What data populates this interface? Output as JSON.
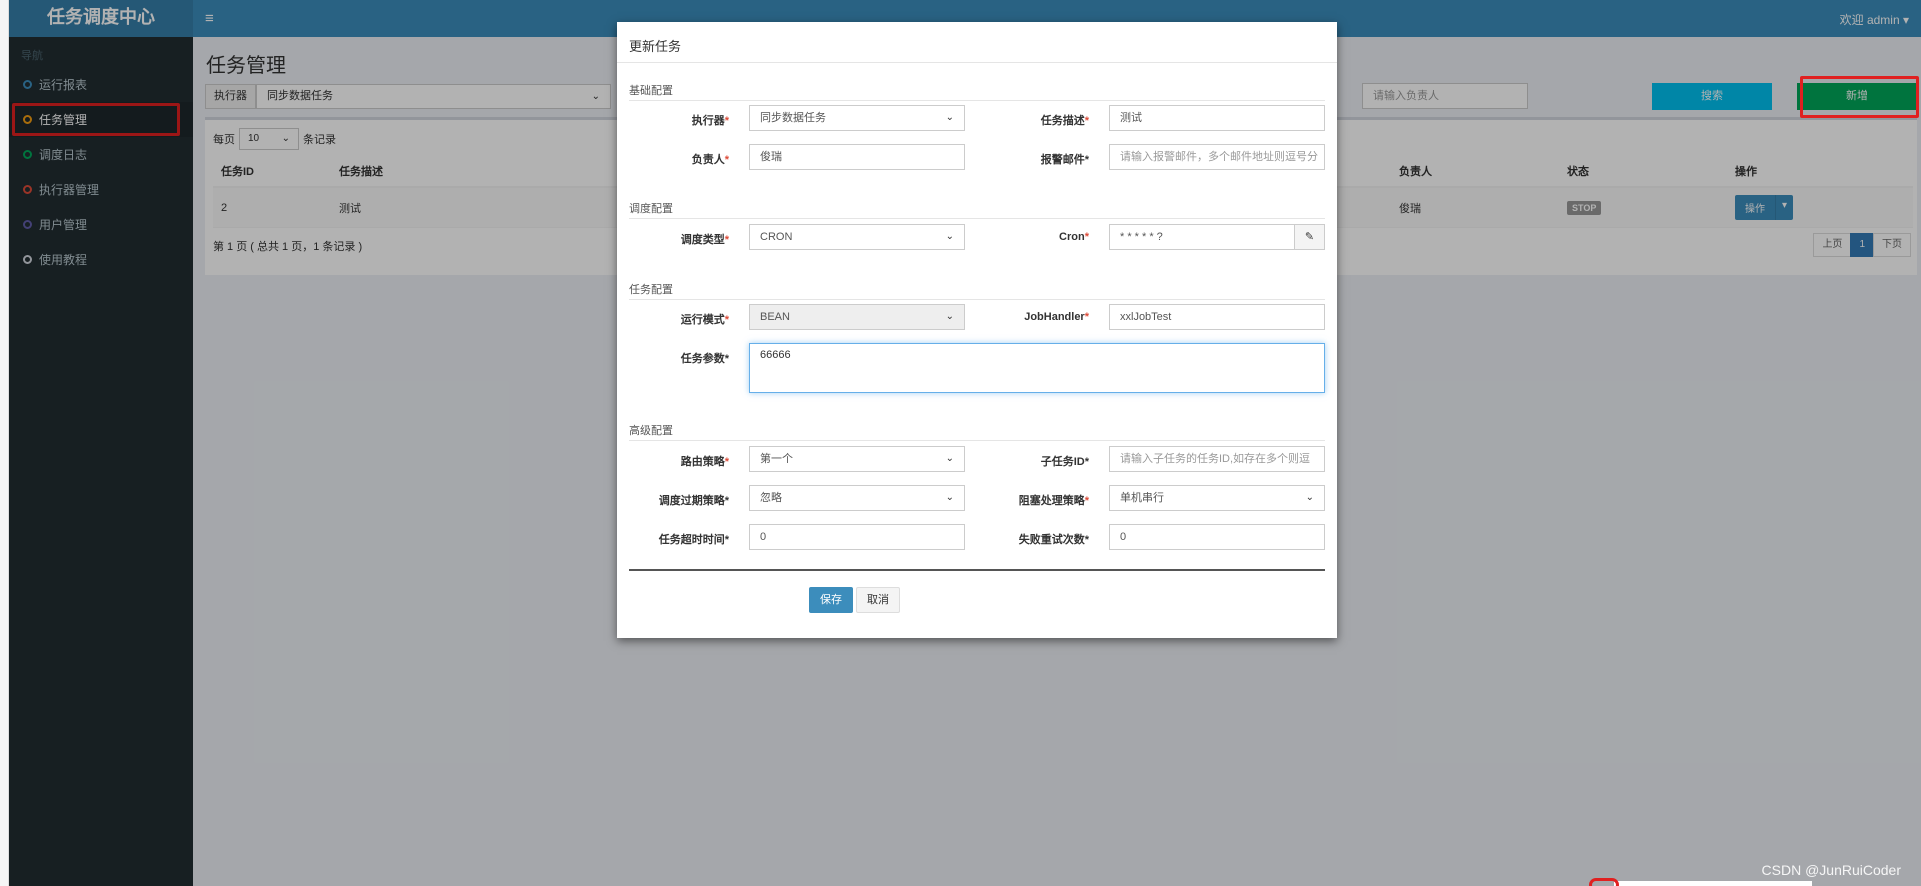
{
  "app": {
    "brand": "任务调度中心",
    "hamburger_icon": "≡",
    "welcome": "欢迎 admin ▾"
  },
  "sidebar": {
    "header": "导航",
    "items": [
      {
        "label": "运行报表",
        "color": "#3c8dbc"
      },
      {
        "label": "任务管理",
        "color": "#f39c12"
      },
      {
        "label": "调度日志",
        "color": "#00a65a"
      },
      {
        "label": "执行器管理",
        "color": "#dd4b39"
      },
      {
        "label": "用户管理",
        "color": "#605ca8"
      },
      {
        "label": "使用教程",
        "color": "#d2d6de"
      }
    ]
  },
  "page": {
    "title": "任务管理",
    "filter": {
      "executor_label": "执行器",
      "executor_value": "同步数据任务"
    },
    "search_placeholder": "请输入负责人",
    "search_button": "搜索",
    "add_button": "新增",
    "per_page_prefix": "每页",
    "per_page_value": "10",
    "per_page_suffix": "条记录",
    "table": {
      "headers": [
        "任务ID",
        "任务描述",
        "负责人",
        "状态",
        "操作"
      ],
      "rows": [
        {
          "id": "2",
          "desc": "测试",
          "owner": "俊瑞",
          "status": "STOP",
          "op": "操作"
        }
      ]
    },
    "page_info": "第 1 页 ( 总共 1 页，1 条记录 )",
    "pager": {
      "prev": "上页",
      "current": "1",
      "next": "下页"
    }
  },
  "modal": {
    "title": "更新任务",
    "sections": {
      "basic": "基础配置",
      "schedule": "调度配置",
      "task": "任务配置",
      "advanced": "高级配置"
    },
    "fields": {
      "executor": {
        "label": "执行器",
        "value": "同步数据任务"
      },
      "job_desc": {
        "label": "任务描述",
        "value": "测试"
      },
      "owner": {
        "label": "负责人",
        "value": "俊瑞"
      },
      "alarm_email": {
        "label": "报警邮件",
        "placeholder": "请输入报警邮件，多个邮件地址则逗号分"
      },
      "schedule_type": {
        "label": "调度类型",
        "value": "CRON"
      },
      "cron": {
        "label": "Cron",
        "value": "* * * * * ?"
      },
      "run_mode": {
        "label": "运行模式",
        "value": "BEAN"
      },
      "job_handler": {
        "label": "JobHandler",
        "value": "xxlJobTest"
      },
      "job_param": {
        "label": "任务参数",
        "value": "66666"
      },
      "route_strategy": {
        "label": "路由策略",
        "value": "第一个"
      },
      "child_job": {
        "label": "子任务ID",
        "placeholder": "请输入子任务的任务ID,如存在多个则逗"
      },
      "misfire": {
        "label": "调度过期策略",
        "value": "忽略"
      },
      "block_strategy": {
        "label": "阻塞处理策略",
        "value": "单机串行"
      },
      "timeout": {
        "label": "任务超时时间",
        "value": "0"
      },
      "retry": {
        "label": "失败重试次数",
        "value": "0"
      }
    },
    "save": "保存",
    "cancel": "取消"
  },
  "watermark": "CSDN @JunRuiCoder"
}
